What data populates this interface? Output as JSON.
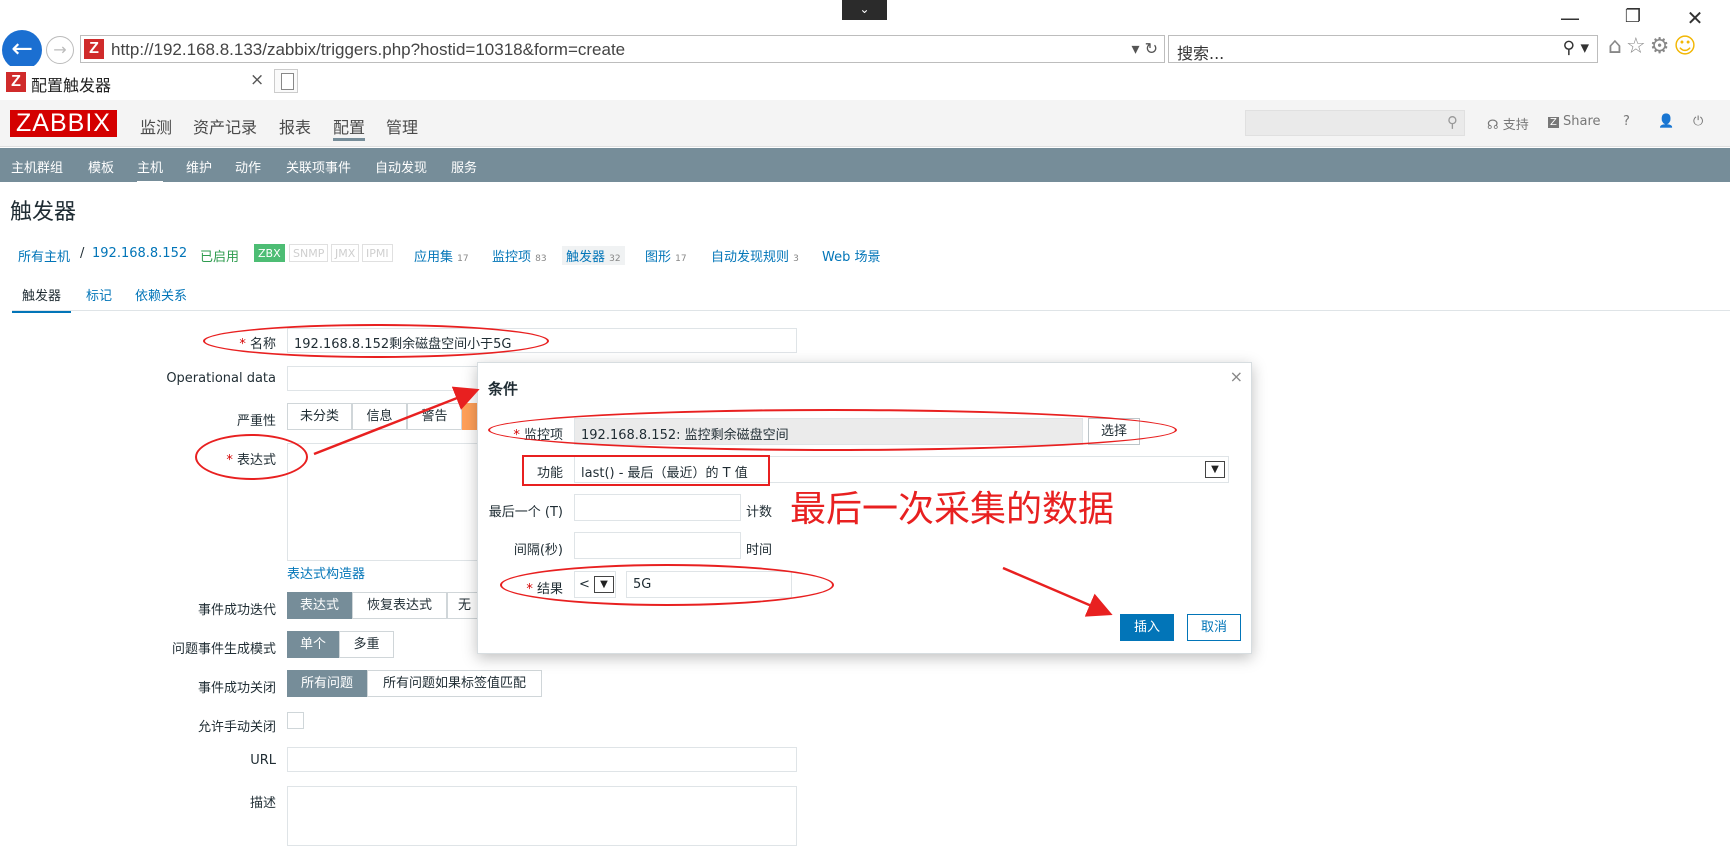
{
  "browser": {
    "url": "http://192.168.8.133/zabbix/triggers.php?hostid=10318&form=create",
    "search_placeholder": "搜索...",
    "tab_title": "配置触发器",
    "favicon_letter": "Z",
    "addr_controls": "▾ ↻",
    "search_icon": "⚲ ▾",
    "minimize": "—",
    "restore": "❐",
    "close": "✕",
    "dropdown": "⌄",
    "tab_close": "×"
  },
  "zabbix": {
    "logo": "ZABBIX",
    "main_menu": [
      "监测",
      "资产记录",
      "报表",
      "配置",
      "管理"
    ],
    "header_links": {
      "support": "支持",
      "share": "Share",
      "help": "?",
      "user": "👤",
      "power": "⏻"
    },
    "sub_menu": [
      "主机群组",
      "模板",
      "主机",
      "维护",
      "动作",
      "关联项事件",
      "自动发现",
      "服务"
    ],
    "page_title": "触发器",
    "breadcrumbs": {
      "all_hosts": "所有主机",
      "separator": "/",
      "host": "192.168.8.152",
      "enabled": "已启用",
      "tags": [
        "ZBX",
        "SNMP",
        "JMX",
        "IPMI"
      ],
      "links": [
        {
          "label": "应用集",
          "count": "17"
        },
        {
          "label": "监控项",
          "count": "83"
        },
        {
          "label": "触发器",
          "count": "32"
        },
        {
          "label": "图形",
          "count": "17"
        },
        {
          "label": "自动发现规则",
          "count": "3"
        }
      ],
      "web": "Web 场景"
    },
    "form_tabs": [
      "触发器",
      "标记",
      "依赖关系"
    ]
  },
  "form": {
    "name_label": "名称",
    "name_value": "192.168.8.152剩余磁盘空间小于5G",
    "opdata_label": "Operational data",
    "severity_label": "严重性",
    "severity_options": [
      "未分类",
      "信息",
      "警告"
    ],
    "expression_label": "表达式",
    "expression_builder": "表达式构造器",
    "ok_event_label": "事件成功迭代",
    "ok_event_options": [
      "表达式",
      "恢复表达式",
      "无"
    ],
    "problem_mode_label": "问题事件生成模式",
    "problem_mode_options": [
      "单个",
      "多重"
    ],
    "ok_close_label": "事件成功关闭",
    "ok_close_options": [
      "所有问题",
      "所有问题如果标签值匹配"
    ],
    "manual_close_label": "允许手动关闭",
    "url_label": "URL",
    "desc_label": "描述",
    "required_mark": "*"
  },
  "modal": {
    "title": "条件",
    "close": "×",
    "item_label": "监控项",
    "item_value": "192.168.8.152: 监控剩余磁盘空间",
    "select_button": "选择",
    "function_label": "功能",
    "function_value": "last() - 最后（最近）的 T 值",
    "last_t_label": "最后一个 (T)",
    "last_t_unit": "计数",
    "interval_label": "间隔(秒)",
    "interval_unit": "时间",
    "result_label": "结果",
    "result_operator": "<",
    "result_value": "5G",
    "insert_button": "插入",
    "cancel_button": "取消"
  },
  "annotation": {
    "text": "最后一次采集的数据",
    "color": "#e82020"
  },
  "colors": {
    "zabbix_red": "#d40000",
    "submenu_bg": "#768d99",
    "link_blue": "#0275b8",
    "enabled_green": "#4dbd74"
  }
}
